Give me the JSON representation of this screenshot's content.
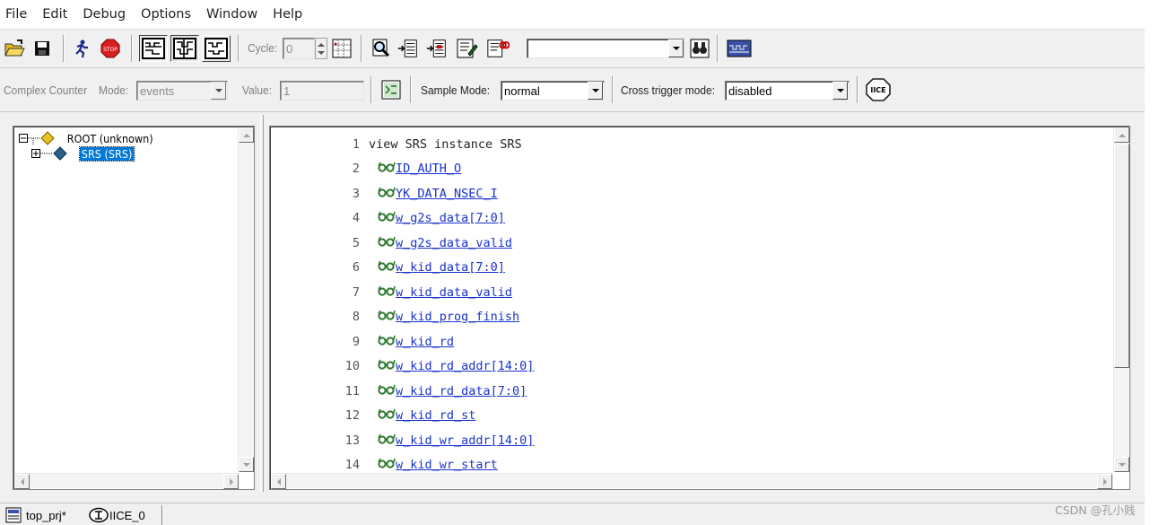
{
  "menu": [
    "File",
    "Edit",
    "Debug",
    "Options",
    "Window",
    "Help"
  ],
  "toolbar1": {
    "cycle_label": "Cycle:",
    "cycle_value": "0",
    "combo_value": ""
  },
  "toolbar2": {
    "complex_counter_label": "Complex Counter",
    "mode_label": "Mode:",
    "mode_value": "events",
    "value_label": "Value:",
    "value_value": "1",
    "sample_mode_label": "Sample Mode:",
    "sample_mode_value": "normal",
    "cross_trigger_label": "Cross trigger mode:",
    "cross_trigger_value": "disabled",
    "iice_icon_text": "IICE"
  },
  "tree": {
    "root_label": "ROOT (unknown)",
    "child_label": "SRS (SRS)"
  },
  "code": {
    "header_line_number": "1",
    "header_text": "view SRS instance SRS",
    "signals": [
      {
        "n": "2",
        "name": "ID_AUTH_O"
      },
      {
        "n": "3",
        "name": "YK_DATA_NSEC_I"
      },
      {
        "n": "4",
        "name": "w_g2s_data[7:0]"
      },
      {
        "n": "5",
        "name": "w_g2s_data_valid"
      },
      {
        "n": "6",
        "name": "w_kid_data[7:0]"
      },
      {
        "n": "7",
        "name": "w_kid_data_valid"
      },
      {
        "n": "8",
        "name": "w_kid_prog_finish"
      },
      {
        "n": "9",
        "name": "w_kid_rd"
      },
      {
        "n": "10",
        "name": "w_kid_rd_addr[14:0]"
      },
      {
        "n": "11",
        "name": "w_kid_rd_data[7:0]"
      },
      {
        "n": "12",
        "name": "w_kid_rd_st"
      },
      {
        "n": "13",
        "name": "w_kid_wr_addr[14:0]"
      },
      {
        "n": "14",
        "name": "w_kid_wr_start"
      }
    ]
  },
  "tabs": [
    {
      "label": "top_prj*"
    },
    {
      "label": "IICE_0"
    }
  ],
  "watermark": "CSDN @孔小贱",
  "colors": {
    "selection": "#0078d7",
    "link": "#1a33cc",
    "glasses": "#2f7a2f"
  }
}
